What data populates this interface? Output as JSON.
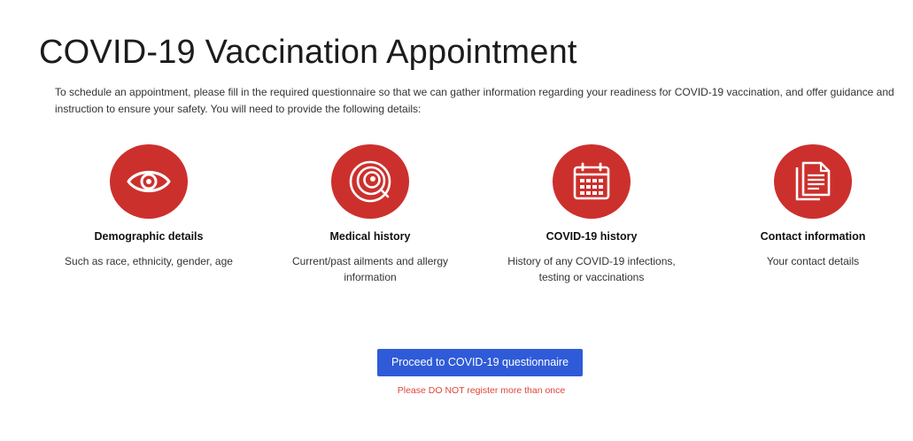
{
  "header": {
    "title": "COVID-19 Vaccination Appointment",
    "intro": "To schedule an appointment, please fill in the required questionnaire so that we can gather information regarding your readiness for COVID-19 vaccination, and offer guidance and instruction to ensure your safety. You will need to provide the following details:"
  },
  "cards": [
    {
      "icon": "eye-icon",
      "title": "Demographic details",
      "description": "Such as race, ethnicity, gender, age"
    },
    {
      "icon": "spiral-icon",
      "title": "Medical history",
      "description": "Current/past ailments and allergy information"
    },
    {
      "icon": "calendar-icon",
      "title": "COVID-19 history",
      "description": "History of any COVID-19 infections, testing or vaccinations"
    },
    {
      "icon": "document-icon",
      "title": "Contact information",
      "description": "Your contact details"
    }
  ],
  "actions": {
    "proceed_label": "Proceed to COVID-19 questionnaire",
    "warning": "Please DO NOT register more than once"
  },
  "colors": {
    "icon_background": "#cc302d",
    "button_background": "#2f5bd8",
    "warning_text": "#e0443a"
  }
}
